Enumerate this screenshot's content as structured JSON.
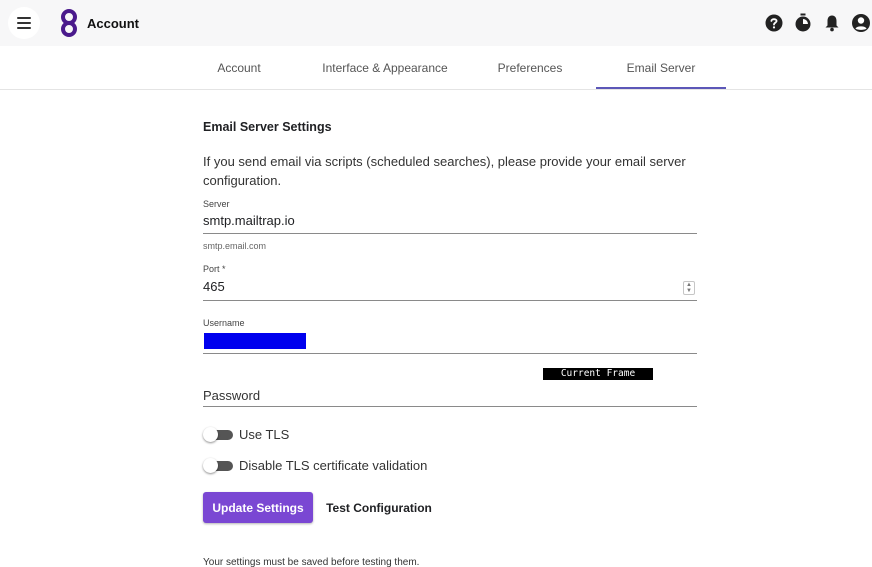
{
  "header": {
    "title": "Account",
    "icons": [
      "menu-icon",
      "app-logo-icon",
      "help-icon",
      "timer-icon",
      "bell-icon",
      "account-icon"
    ]
  },
  "tabs": [
    {
      "label": "Account",
      "active": false
    },
    {
      "label": "Interface & Appearance",
      "active": false
    },
    {
      "label": "Preferences",
      "active": false
    },
    {
      "label": "Email Server",
      "active": true
    }
  ],
  "settings": {
    "title": "Email Server Settings",
    "description": "If you send email via scripts (scheduled searches), please provide your email server configuration.",
    "server": {
      "label": "Server",
      "value": "smtp.mailtrap.io",
      "hint": "smtp.email.com"
    },
    "port": {
      "label": "Port *",
      "value": "465"
    },
    "username": {
      "label": "Username",
      "redacted": true
    },
    "overlay_tag": "Current Frame",
    "password": {
      "label": "Password",
      "value": ""
    },
    "toggles": [
      {
        "label": "Use TLS",
        "on": false
      },
      {
        "label": "Disable TLS certificate validation",
        "on": false
      }
    ],
    "buttons": {
      "update": "Update Settings",
      "test": "Test Configuration"
    },
    "footnote": "Your settings must be saved before testing them."
  },
  "colors": {
    "primary": "#7a47d3",
    "tab_indicator": "#5c57b8",
    "redaction": "#0000ee",
    "topbar": "#f7f7f8"
  }
}
